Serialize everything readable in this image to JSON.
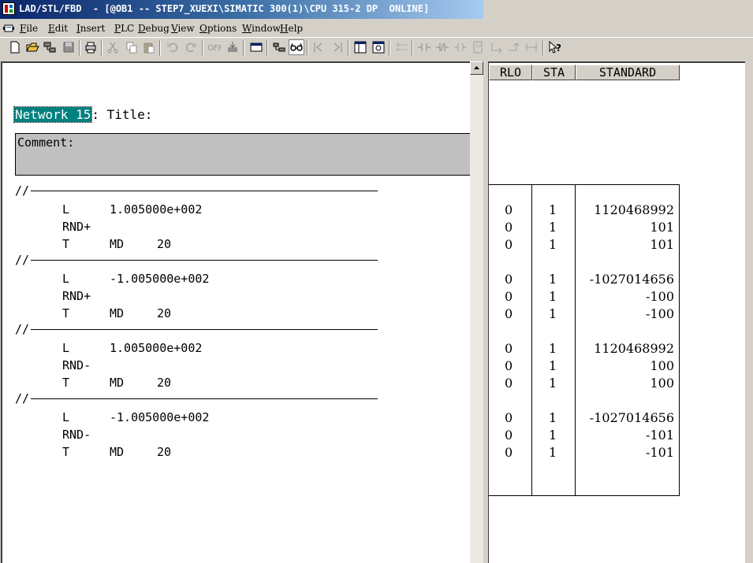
{
  "window": {
    "title": "LAD/STL/FBD  - [@OB1 -- STEP7_XUEXI\\SIMATIC 300(1)\\CPU 315-2 DP  ONLINE]"
  },
  "menu": [
    {
      "label": "File",
      "accel": "F",
      "rest": "ile"
    },
    {
      "label": "Edit",
      "accel": "E",
      "rest": "dit"
    },
    {
      "label": "Insert",
      "accel": "I",
      "rest": "nsert"
    },
    {
      "label": "PLC",
      "accel": "P",
      "rest": "LC"
    },
    {
      "label": "Debug",
      "accel": "D",
      "rest": "ebug"
    },
    {
      "label": "View",
      "accel": "V",
      "rest": "iew"
    },
    {
      "label": "Options",
      "accel": "O",
      "rest": "ptions"
    },
    {
      "label": "Window",
      "accel": "W",
      "rest": "indow"
    },
    {
      "label": "Help",
      "accel": "H",
      "rest": "elp"
    }
  ],
  "toolbar": {
    "icons": [
      "new-icon",
      "open-icon",
      "accessible-nodes-icon",
      "save-icon",
      "print-icon",
      "cut-icon",
      "copy-icon",
      "paste-icon",
      "undo-icon",
      "redo-icon",
      "load-icon",
      "download-icon",
      "overview-icon",
      "monitor-icon",
      "glasses-icon",
      "first-network-icon",
      "last-network-icon",
      "split-view-icon",
      "zoom-icon",
      "new-network-icon",
      "contact-no-icon",
      "contact-nc-icon",
      "coil-icon",
      "box-icon",
      "branch-open-icon",
      "branch-close-icon",
      "connection-icon",
      "help-context-icon"
    ]
  },
  "network": {
    "label": "Network 15",
    "title_text": ": Title:",
    "comment_label": "Comment:"
  },
  "separator": "//",
  "code": [
    {
      "instr": "L",
      "operand": "1.005000e+002",
      "addr": ""
    },
    {
      "instr": "RND+",
      "operand": "",
      "addr": ""
    },
    {
      "instr": "T",
      "operand": "MD",
      "addr": "20"
    },
    {
      "instr": "L",
      "operand": "-1.005000e+002",
      "addr": ""
    },
    {
      "instr": "RND+",
      "operand": "",
      "addr": ""
    },
    {
      "instr": "T",
      "operand": "MD",
      "addr": "20"
    },
    {
      "instr": "L",
      "operand": "1.005000e+002",
      "addr": ""
    },
    {
      "instr": "RND-",
      "operand": "",
      "addr": ""
    },
    {
      "instr": "T",
      "operand": "MD",
      "addr": "20"
    },
    {
      "instr": "L",
      "operand": "-1.005000e+002",
      "addr": ""
    },
    {
      "instr": "RND-",
      "operand": "",
      "addr": ""
    },
    {
      "instr": "T",
      "operand": "MD",
      "addr": "20"
    }
  ],
  "status": {
    "headers": [
      "RLO",
      "STA",
      "STANDARD"
    ],
    "rows": [
      {
        "rlo": "0",
        "sta": "1",
        "std": "1120468992"
      },
      {
        "rlo": "0",
        "sta": "1",
        "std": "101"
      },
      {
        "rlo": "0",
        "sta": "1",
        "std": "101"
      },
      {
        "rlo": "0",
        "sta": "1",
        "std": "-1027014656"
      },
      {
        "rlo": "0",
        "sta": "1",
        "std": "-100"
      },
      {
        "rlo": "0",
        "sta": "1",
        "std": "-100"
      },
      {
        "rlo": "0",
        "sta": "1",
        "std": "1120468992"
      },
      {
        "rlo": "0",
        "sta": "1",
        "std": "100"
      },
      {
        "rlo": "0",
        "sta": "1",
        "std": "100"
      },
      {
        "rlo": "0",
        "sta": "1",
        "std": "-1027014656"
      },
      {
        "rlo": "0",
        "sta": "1",
        "std": "-101"
      },
      {
        "rlo": "0",
        "sta": "1",
        "std": "-101"
      }
    ]
  },
  "colors": {
    "title_bar_start": "#0a246a",
    "selection": "#00807f",
    "comment_bg": "#c0c0c0"
  }
}
